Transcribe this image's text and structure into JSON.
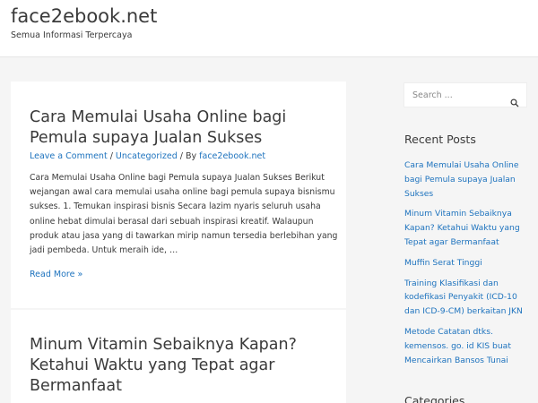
{
  "header": {
    "site_title": "face2ebook.net",
    "site_description": "Semua Informasi Terpercaya"
  },
  "articles": [
    {
      "title": "Cara Memulai Usaha Online bagi Pemula supaya Jualan Sukses",
      "meta_comment": "Leave a Comment",
      "meta_sep1": " / ",
      "meta_category": "Uncategorized",
      "meta_by": " / By ",
      "meta_author": "face2ebook.net",
      "excerpt": "Cara Memulai Usaha Online bagi Pemula supaya Jualan Sukses Berikut wejangan awal cara memulai usaha online bagi pemula supaya bisnismu sukses. 1. Temukan inspirasi bisnis Secara lazim nyaris seluruh usaha online hebat dimulai berasal dari sebuah inspirasi kreatif. Walaupun produk atau jasa yang di tawarkan mirip namun tersedia berlebihan yang jadi pembeda. Untuk meraih ide, …",
      "read_more": "Read More »"
    },
    {
      "title": "Minum Vitamin Sebaiknya Kapan? Ketahui Waktu yang Tepat agar Bermanfaat"
    }
  ],
  "sidebar": {
    "search_placeholder": "Search ...",
    "recent_posts_title": "Recent Posts",
    "recent_posts": [
      "Cara Memulai Usaha Online bagi Pemula supaya Jualan Sukses",
      "Minum Vitamin Sebaiknya Kapan? Ketahui Waktu yang Tepat agar Bermanfaat",
      "Muffin Serat Tinggi",
      "Training Klasifikasi dan kodefikasi Penyakit (ICD-10 dan ICD-9-CM) berkaitan JKN",
      "Metode Catatan dtks. kemensos. go. id KIS buat Mencairkan Bansos Tunai"
    ],
    "categories_title": "Categories"
  },
  "colors": {
    "link": "#1e73be",
    "text": "#3a3a3a",
    "background": "#f5f5f5"
  }
}
